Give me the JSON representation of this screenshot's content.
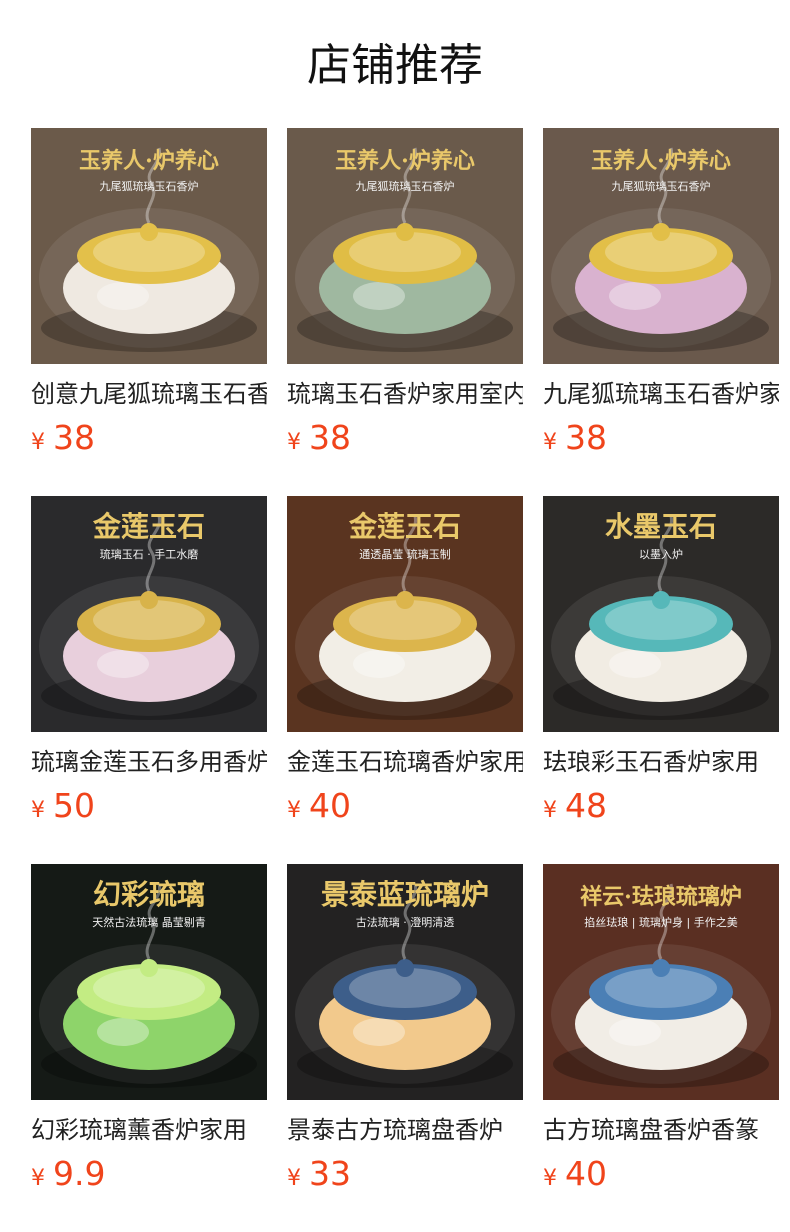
{
  "header": {
    "title": "店铺推荐"
  },
  "currency_symbol": "¥",
  "products": [
    {
      "name": "创意九尾狐琉璃玉石香炉",
      "price": "38",
      "banner": "玉养人·炉养心",
      "subtitle": "九尾狐琉璃玉石香炉",
      "bg": "#6b5a4a",
      "bowl": "#efe9e1",
      "lid": "#e3c04a"
    },
    {
      "name": "琉璃玉石香炉家用室内",
      "price": "38",
      "banner": "玉养人·炉养心",
      "subtitle": "九尾狐琉璃玉石香炉",
      "bg": "#6a5a4b",
      "bowl": "#9fb8a0",
      "lid": "#e0bd45"
    },
    {
      "name": "九尾狐琉璃玉石香炉家用",
      "price": "38",
      "banner": "玉养人·炉养心",
      "subtitle": "九尾狐琉璃玉石香炉",
      "bg": "#6a594c",
      "bowl": "#d9b2cf",
      "lid": "#e2bf48"
    },
    {
      "name": "琉璃金莲玉石多用香炉",
      "price": "50",
      "banner": "金莲玉石",
      "subtitle": "琉璃玉石 · 手工水磨",
      "bg": "#2a2a2c",
      "bowl": "#e8cfdc",
      "lid": "#d8b34a"
    },
    {
      "name": "金莲玉石琉璃香炉家用",
      "price": "40",
      "banner": "金莲玉石",
      "subtitle": "通透晶莹 琉璃玉制",
      "bg": "#5a3420",
      "bowl": "#f2eee6",
      "lid": "#dcb54c"
    },
    {
      "name": "珐琅彩玉石香炉家用",
      "price": "48",
      "banner": "水墨玉石",
      "subtitle": "以墨入炉",
      "bg": "#2c2a28",
      "bowl": "#f1ece3",
      "lid": "#56b8b9"
    },
    {
      "name": "幻彩琉璃薰香炉家用",
      "price": "9.9",
      "banner": "幻彩琉璃",
      "subtitle": "天然古法琉璃 晶莹剔青",
      "bg": "#151a16",
      "bowl": "#8ed46a",
      "lid": "#c3ec83"
    },
    {
      "name": "景泰古方琉璃盘香炉",
      "price": "33",
      "banner": "景泰蓝琉璃炉",
      "subtitle": "古法琉璃 · 澄明清透",
      "bg": "#232222",
      "bowl": "#f2c98c",
      "lid": "#3d5e8a"
    },
    {
      "name": "古方琉璃盘香炉香篆",
      "price": "40",
      "banner": "祥云·珐琅琉璃炉",
      "subtitle": "掐丝珐琅 | 琉璃炉身 | 手作之美",
      "bg": "#5a2f22",
      "bowl": "#f1ede6",
      "lid": "#4b7fb5"
    }
  ]
}
